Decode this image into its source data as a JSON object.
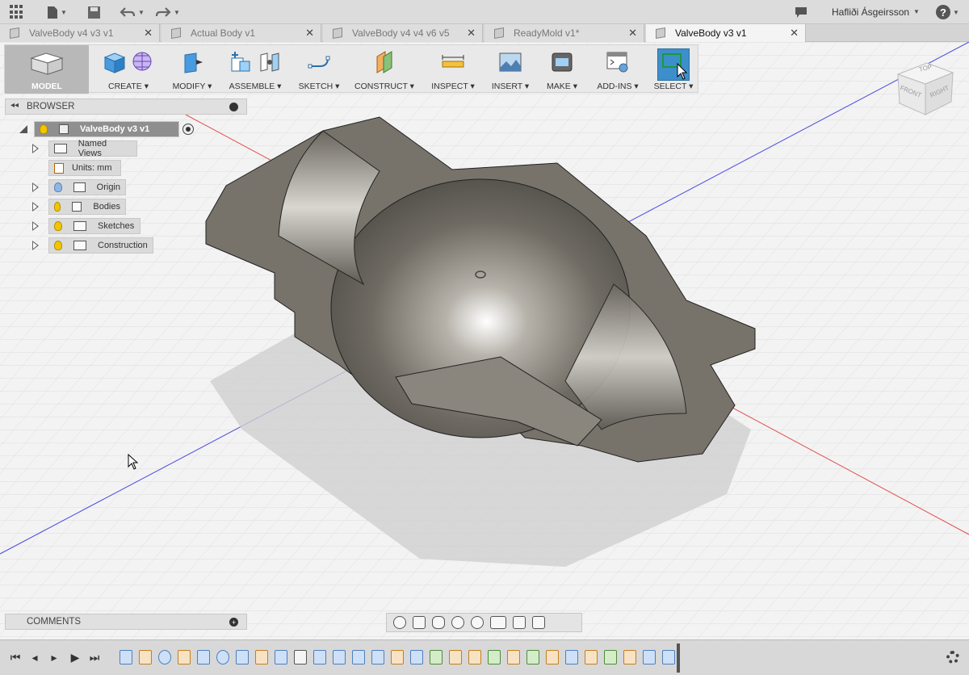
{
  "titlebar": {
    "user": "Hafliði Ásgeirsson"
  },
  "tabs": [
    {
      "label": "ValveBody v4 v3 v1",
      "active": false
    },
    {
      "label": "Actual Body v1",
      "active": false
    },
    {
      "label": "ValveBody v4 v4 v6 v5",
      "active": false
    },
    {
      "label": "ReadyMold v1*",
      "active": false
    },
    {
      "label": "ValveBody v3 v1",
      "active": true
    }
  ],
  "toolbar": {
    "model": "MODEL",
    "create": "CREATE",
    "modify": "MODIFY",
    "assemble": "ASSEMBLE",
    "sketch": "SKETCH",
    "construct": "CONSTRUCT",
    "inspect": "INSPECT",
    "insert": "INSERT",
    "make": "MAKE",
    "addins": "ADD-INS",
    "select": "SELECT"
  },
  "browser": {
    "title": "BROWSER",
    "root": "ValveBody v3 v1",
    "items": [
      {
        "label": "Named Views"
      },
      {
        "label": "Units: mm"
      },
      {
        "label": "Origin"
      },
      {
        "label": "Bodies"
      },
      {
        "label": "Sketches"
      },
      {
        "label": "Construction"
      }
    ]
  },
  "viewcube": {
    "top": "TOP",
    "front": "FRONT",
    "right": "RIGHT"
  },
  "comments": {
    "title": "COMMENTS"
  },
  "colors": {
    "select_active": "#3d8fcc",
    "x_axis": "#e05050",
    "y_axis": "#4a4ae0",
    "part_gray": "#6e6a62"
  }
}
